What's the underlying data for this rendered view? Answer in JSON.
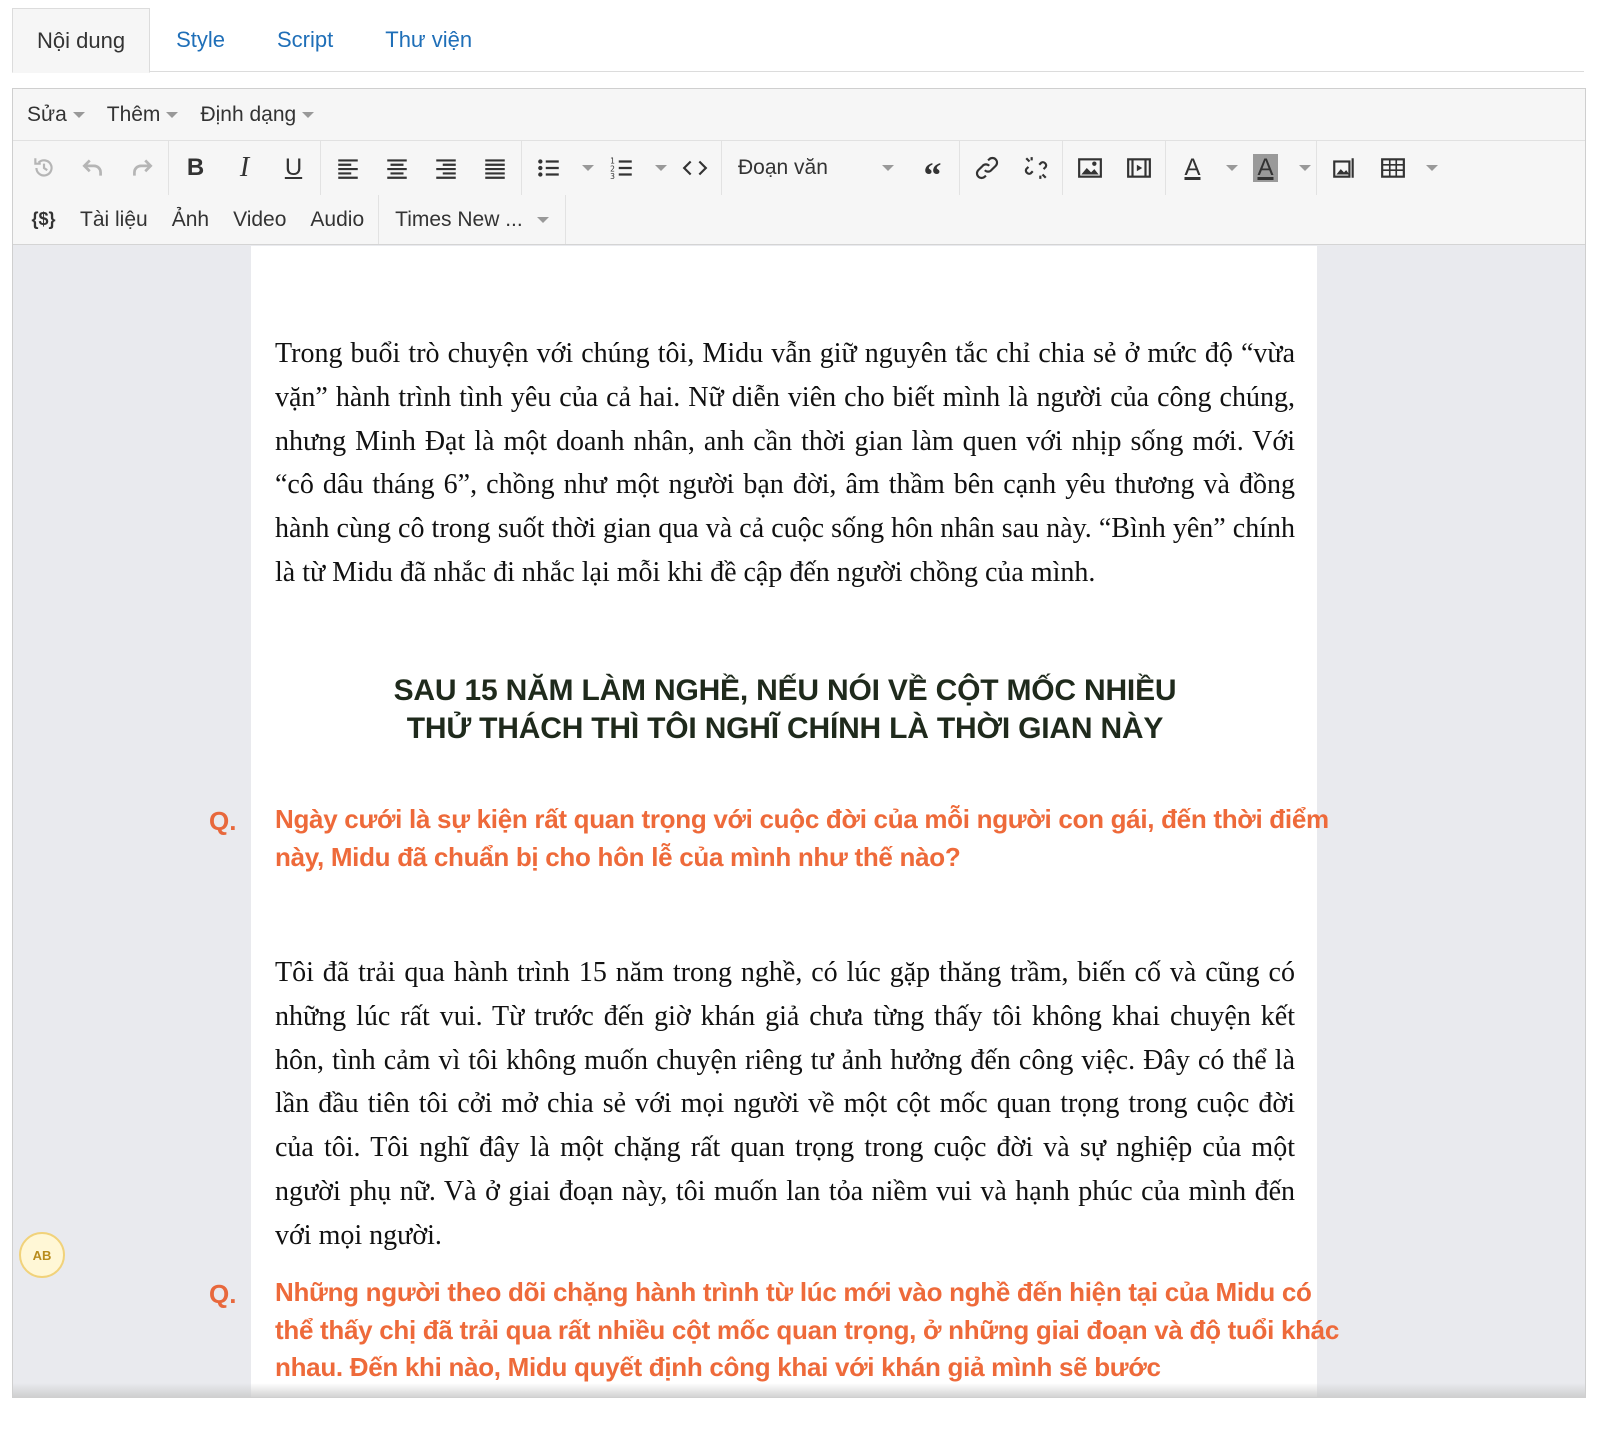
{
  "tabs": [
    {
      "label": "Nội dung",
      "active": true
    },
    {
      "label": "Style"
    },
    {
      "label": "Script"
    },
    {
      "label": "Thư viện"
    }
  ],
  "menubar": {
    "edit": "Sửa",
    "insert": "Thêm",
    "format": "Định dạng"
  },
  "toolbar": {
    "paragraph_format": "Đoạn văn",
    "document": "Tài liệu",
    "image": "Ảnh",
    "video": "Video",
    "audio": "Audio",
    "font": "Times New ..."
  },
  "content": {
    "para1": "Trong buổi trò chuyện với chúng tôi, Midu vẫn giữ nguyên tắc chỉ chia sẻ ở mức độ “vừa vặn” hành trình tình yêu của cả hai. Nữ diễn viên cho biết mình là người của công chúng, nhưng Minh Đạt là một doanh nhân, anh cần thời gian làm quen với nhịp sống mới. Với “cô dâu tháng 6”, chồng như một người bạn đời, âm thầm bên cạnh yêu thương và đồng hành cùng cô trong suốt thời gian qua và cả cuộc sống hôn nhân sau này. “Bình yên” chính là từ Midu đã nhắc đi nhắc lại mỗi khi đề cập đến người chồng của mình.",
    "heading_line1": "SAU 15 NĂM LÀM NGHỀ, NẾU NÓI VỀ CỘT MỐC NHIỀU",
    "heading_line2": "THỬ THÁCH THÌ TÔI NGHĨ CHÍNH LÀ THỜI GIAN NÀY",
    "q_label": "Q.",
    "q1": "Ngày cưới là sự kiện rất quan trọng với cuộc đời của mỗi người con gái, đến thời điểm này, Midu đã chuẩn bị cho hôn lễ của mình như thế nào?",
    "para2": "Tôi đã trải qua hành trình 15 năm trong nghề, có lúc gặp thăng trầm, biến cố và cũng có những lúc rất vui. Từ trước đến giờ khán giả chưa từng thấy tôi không khai chuyện kết hôn, tình cảm vì tôi không muốn chuyện riêng tư ảnh hưởng đến công việc. Đây có thể là lần đầu tiên tôi cởi mở chia sẻ với mọi người về một cột mốc quan trọng trong cuộc đời của tôi. Tôi nghĩ đây là một chặng rất quan trọng trong cuộc đời và sự nghiệp của một người phụ nữ. Và ở giai đoạn này, tôi muốn lan tỏa niềm vui và hạnh phúc của mình đến với mọi người.",
    "q2": "Những người theo dõi chặng hành trình từ lúc mới vào nghề đến hiện tại của Midu có thể thấy chị đã trải qua rất nhiều cột mốc quan trọng, ở những giai đoạn và độ tuổi khác nhau. Đến khi nào, Midu quyết định công khai với khán giả mình sẽ bước"
  },
  "spellcheck_badge": "AB",
  "colors": {
    "tab_link": "#1f6fb8",
    "question_orange": "#ee6a3a",
    "heading_dark": "#1f2a1c"
  }
}
